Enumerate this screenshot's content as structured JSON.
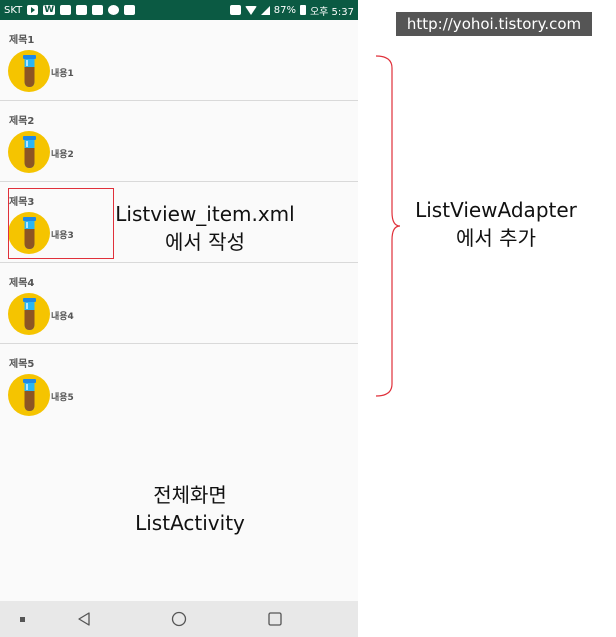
{
  "watermark": "http://yohoi.tistory.com",
  "status_bar": {
    "carrier": "SKT",
    "battery": "87%",
    "time": "오후 5:37"
  },
  "list_items": [
    {
      "title": "제목1",
      "content": "내용1"
    },
    {
      "title": "제목2",
      "content": "내용2"
    },
    {
      "title": "제목3",
      "content": "내용3"
    },
    {
      "title": "제목4",
      "content": "내용4"
    },
    {
      "title": "제목5",
      "content": "내용5"
    }
  ],
  "annotations": {
    "item_xml": {
      "line1": "Listview_item.xml",
      "line2": "에서 작성"
    },
    "adapter": {
      "line1": "ListViewAdapter",
      "line2": "에서 추가"
    },
    "activity": {
      "line1": "전체화면",
      "line2": "ListActivity"
    }
  },
  "nav": {
    "back_icon": "triangle-back-icon",
    "home_icon": "circle-home-icon",
    "recent_icon": "square-recent-icon"
  },
  "colors": {
    "status_bar": "#0b5a43",
    "avatar": "#f5c400",
    "annotation_red": "#e0303a"
  }
}
